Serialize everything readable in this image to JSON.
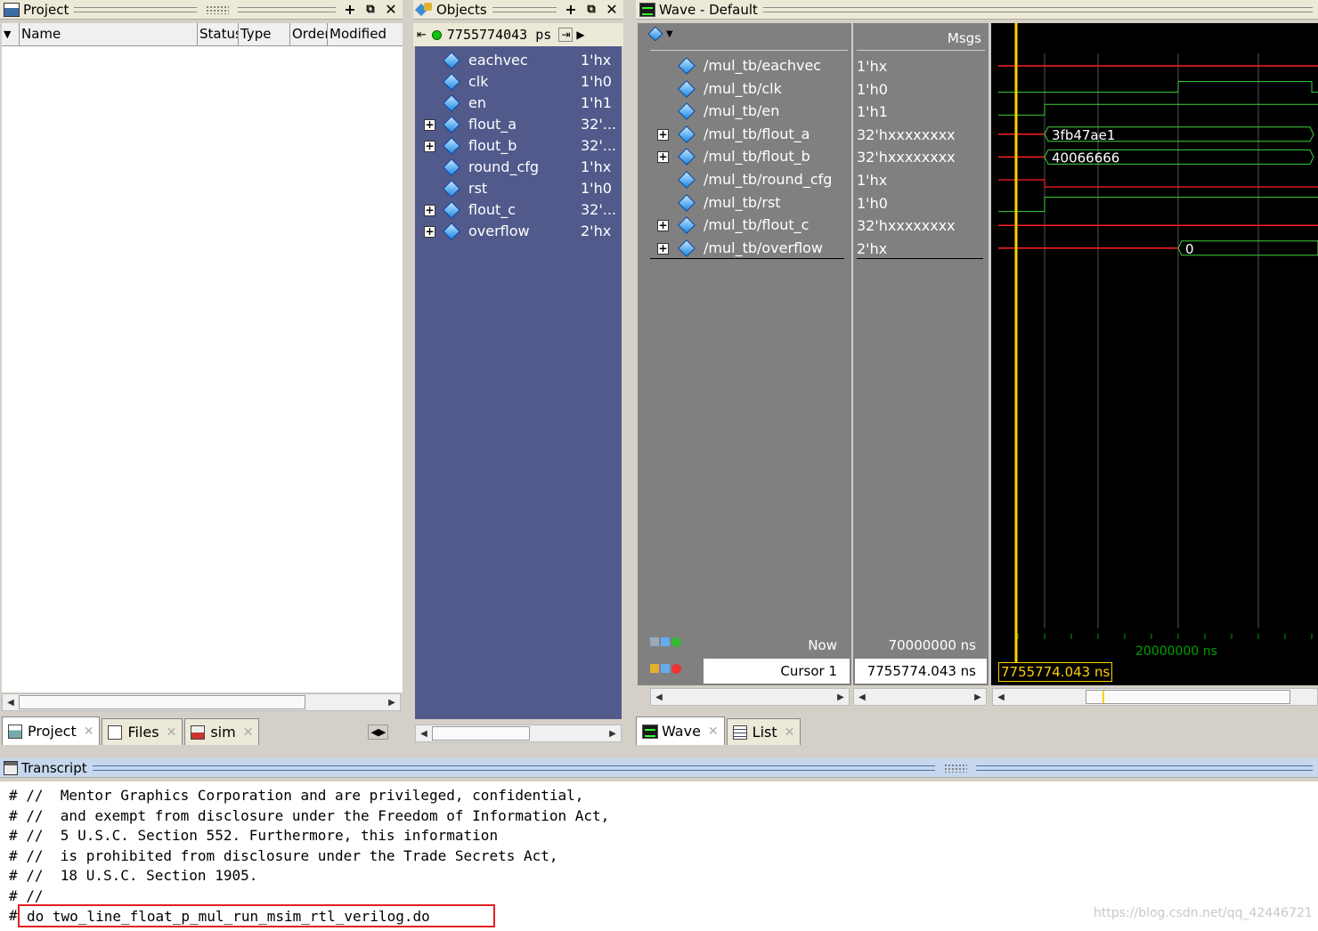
{
  "project": {
    "title": "Project",
    "columns": [
      "Name",
      "Status",
      "Type",
      "Order",
      "Modified"
    ]
  },
  "bottom_tabs_left": [
    {
      "label": "Project"
    },
    {
      "label": "Files"
    },
    {
      "label": "sim"
    }
  ],
  "objects": {
    "title": "Objects",
    "time": "7755774043 ps",
    "items": [
      {
        "name": "eachvec",
        "value": "1'hx",
        "expand": false
      },
      {
        "name": "clk",
        "value": "1'h0",
        "expand": false
      },
      {
        "name": "en",
        "value": "1'h1",
        "expand": false
      },
      {
        "name": "flout_a",
        "value": "32'...",
        "expand": true
      },
      {
        "name": "flout_b",
        "value": "32'...",
        "expand": true
      },
      {
        "name": "round_cfg",
        "value": "1'hx",
        "expand": false
      },
      {
        "name": "rst",
        "value": "1'h0",
        "expand": false
      },
      {
        "name": "flout_c",
        "value": "32'...",
        "expand": true
      },
      {
        "name": "overflow",
        "value": "2'hx",
        "expand": true
      }
    ]
  },
  "wave": {
    "title": "Wave - Default",
    "msgs_label": "Msgs",
    "signals": [
      {
        "path": "/mul_tb/eachvec",
        "value": "1'hx",
        "expand": false
      },
      {
        "path": "/mul_tb/clk",
        "value": "1'h0",
        "expand": false
      },
      {
        "path": "/mul_tb/en",
        "value": "1'h1",
        "expand": false
      },
      {
        "path": "/mul_tb/flout_a",
        "value": "32'hxxxxxxxx",
        "expand": true
      },
      {
        "path": "/mul_tb/flout_b",
        "value": "32'hxxxxxxxx",
        "expand": true
      },
      {
        "path": "/mul_tb/round_cfg",
        "value": "1'hx",
        "expand": false
      },
      {
        "path": "/mul_tb/rst",
        "value": "1'h0",
        "expand": false
      },
      {
        "path": "/mul_tb/flout_c",
        "value": "32'hxxxxxxxx",
        "expand": true
      },
      {
        "path": "/mul_tb/overflow",
        "value": "2'hx",
        "expand": true
      }
    ],
    "bus_labels": {
      "flout_a": "3fb47ae1",
      "flout_b": "40066666",
      "overflow": "0"
    },
    "now_label": "Now",
    "now_value": "70000000 ns",
    "cursor_label": "Cursor 1",
    "cursor_value": "7755774.043 ns",
    "cursor_tag": "7755774.043 ns",
    "ruler_label": "20000000 ns",
    "colors": {
      "undefined": "#ff2020",
      "valid": "#3cd23c",
      "cursor": "#ffd000",
      "background": "#000000"
    }
  },
  "bottom_tabs_right": [
    {
      "label": "Wave"
    },
    {
      "label": "List"
    }
  ],
  "transcript": {
    "title": "Transcript",
    "lines": [
      "# //  Mentor Graphics Corporation and are privileged, confidential,",
      "# //  and exempt from disclosure under the Freedom of Information Act,",
      "# //  5 U.S.C. Section 552. Furthermore, this information",
      "# //  is prohibited from disclosure under the Trade Secrets Act,",
      "# //  18 U.S.C. Section 1905.",
      "# //"
    ],
    "command_prefix": "#",
    "command": "do two_line_float_p_mul_run_msim_rtl_verilog.do"
  },
  "watermark": "https://blog.csdn.net/qq_42446721"
}
